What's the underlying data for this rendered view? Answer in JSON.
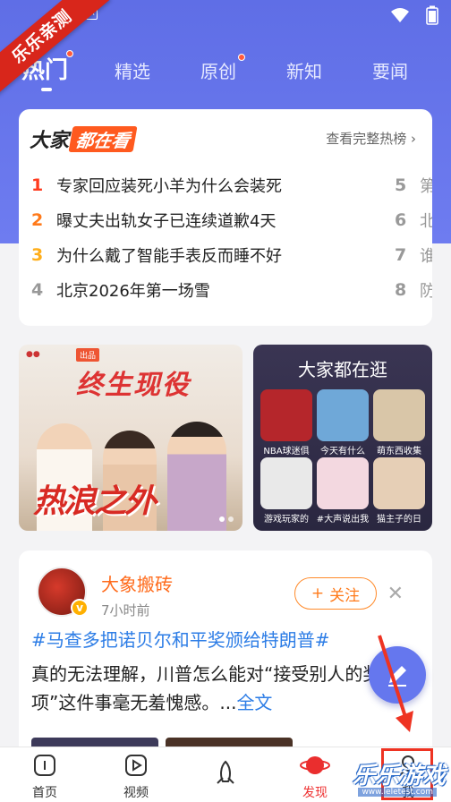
{
  "watermark_ribbon": "乐乐亲测",
  "tabs": [
    {
      "label": "热门",
      "active": true,
      "dot": true
    },
    {
      "label": "精选",
      "active": false,
      "dot": false
    },
    {
      "label": "原创",
      "active": false,
      "dot": true
    },
    {
      "label": "新知",
      "active": false,
      "dot": false
    },
    {
      "label": "要闻",
      "active": false,
      "dot": false
    }
  ],
  "hot": {
    "logo_a": "大家",
    "logo_b": "都在看",
    "more": "查看完整热榜",
    "items": [
      {
        "rank": "1",
        "title": "专家回应装死小羊为什么会装死"
      },
      {
        "rank": "2",
        "title": "曝丈夫出轨女子已连续道歉4天"
      },
      {
        "rank": "3",
        "title": "为什么戴了智能手表反而睡不好"
      },
      {
        "rank": "4",
        "title": "北京2026年第一场雪"
      }
    ],
    "items_right": [
      {
        "rank": "5",
        "title": "第"
      },
      {
        "rank": "6",
        "title": "北"
      },
      {
        "rank": "7",
        "title": "谁"
      },
      {
        "rank": "8",
        "title": "防"
      }
    ]
  },
  "banner": {
    "title": "终生现役",
    "big_title": "热浪之外",
    "tag": "出品"
  },
  "stroll": {
    "title": "大家都在逛",
    "tiles": [
      {
        "label": "NBA球迷俱",
        "bg": "#b5262b"
      },
      {
        "label": "今天有什么",
        "bg": "#6fa8d8"
      },
      {
        "label": "萌东西收集",
        "bg": "#d9c6a8"
      },
      {
        "label": "游戏玩家的",
        "bg": "#e9e9e9"
      },
      {
        "label": "#大声说出我",
        "bg": "#f3d8e0"
      },
      {
        "label": "猫主子的日",
        "bg": "#e6cfb6"
      }
    ]
  },
  "feed": {
    "user": "大象搬砖",
    "time": "7小时前",
    "follow": "关注",
    "topic": "#马查多把诺贝尔和平奖颁给特朗普#",
    "text": "真的无法理解，川普怎么能对“接受别人的奖项”这件事毫无羞愧感。...",
    "more": "全文"
  },
  "nav": [
    {
      "label": "首页",
      "icon": "home-icon"
    },
    {
      "label": "视频",
      "icon": "play-icon"
    },
    {
      "label": "",
      "icon": "rocket-icon"
    },
    {
      "label": "发现",
      "icon": "planet-icon",
      "active": true
    },
    {
      "label": "我",
      "icon": "profile-icon"
    }
  ],
  "site_watermark": "乐乐游戏",
  "site_watermark_sub": "www.leletest.com",
  "colors": {
    "header_bg": "#6472ea",
    "accent_red": "#e33333",
    "link_blue": "#2d7de6",
    "follow_orange": "#ff7a1a",
    "fab": "#6577ee"
  }
}
